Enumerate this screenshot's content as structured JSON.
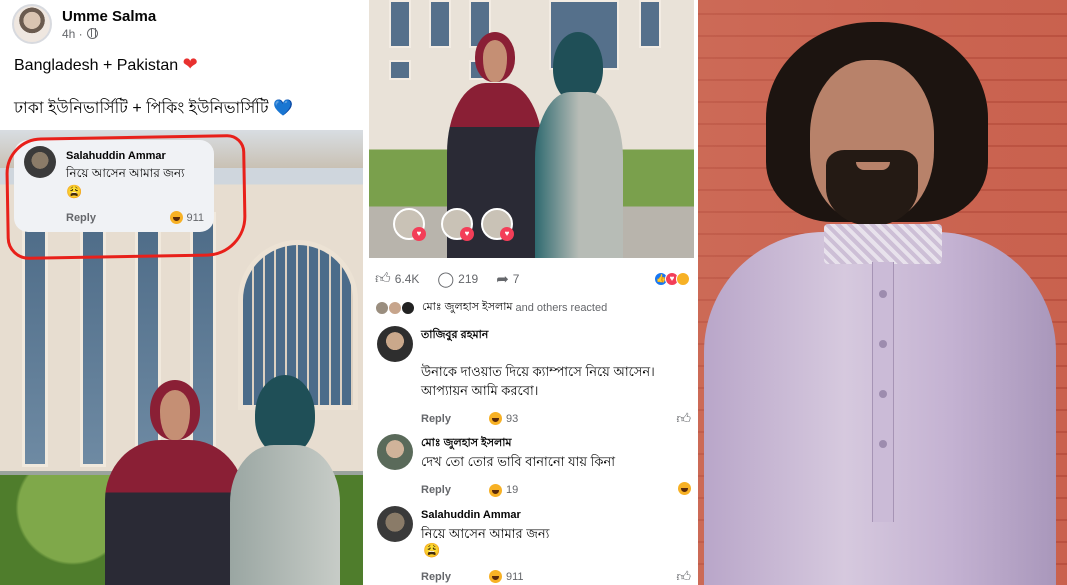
{
  "left_post": {
    "author": "Umme Salma",
    "time": "4h ·",
    "line1": "Bangladesh + Pakistan",
    "line1_emoji": "❤",
    "line2": "ঢাকা ইউনিভার্সিটি + পিকিং ইউনিভার্সিটি",
    "line2_emoji": "💙",
    "comment": {
      "author": "Salahuddin Ammar",
      "text": "নিয়ে আসেন আমার জন্য",
      "emoji": "😩",
      "reply_label": "Reply",
      "reaction_count": "911"
    }
  },
  "middle_post": {
    "likes": "6.4K",
    "comments": "219",
    "shares": "7",
    "reacted_name": "মোঃ জুলহাস ইসলাম",
    "reacted_suffix": "and others reacted",
    "comments_list": [
      {
        "author": "তাজিবুর রহমান",
        "text": "উনাকে দাওয়াত দিয়ে ক্যাম্পাসে নিয়ে আসেন। আপ্যায়ন আমি করবো।",
        "reply_label": "Reply",
        "reaction_count": "93"
      },
      {
        "author": "মোঃ জুলহাস ইসলাম",
        "text": "দেখ তো তোর ভাবি বানানো যায় কিনা",
        "reply_label": "Reply",
        "reaction_count": "19"
      },
      {
        "author": "Salahuddin Ammar",
        "text": "নিয়ে আসেন আমার জন্য",
        "emoji": "😩",
        "reply_label": "Reply",
        "reaction_count": "911"
      }
    ]
  },
  "colors": {
    "facebook_gray": "#65676b",
    "highlight_red": "#e8201a",
    "comment_bubble": "#f0f2f5"
  }
}
